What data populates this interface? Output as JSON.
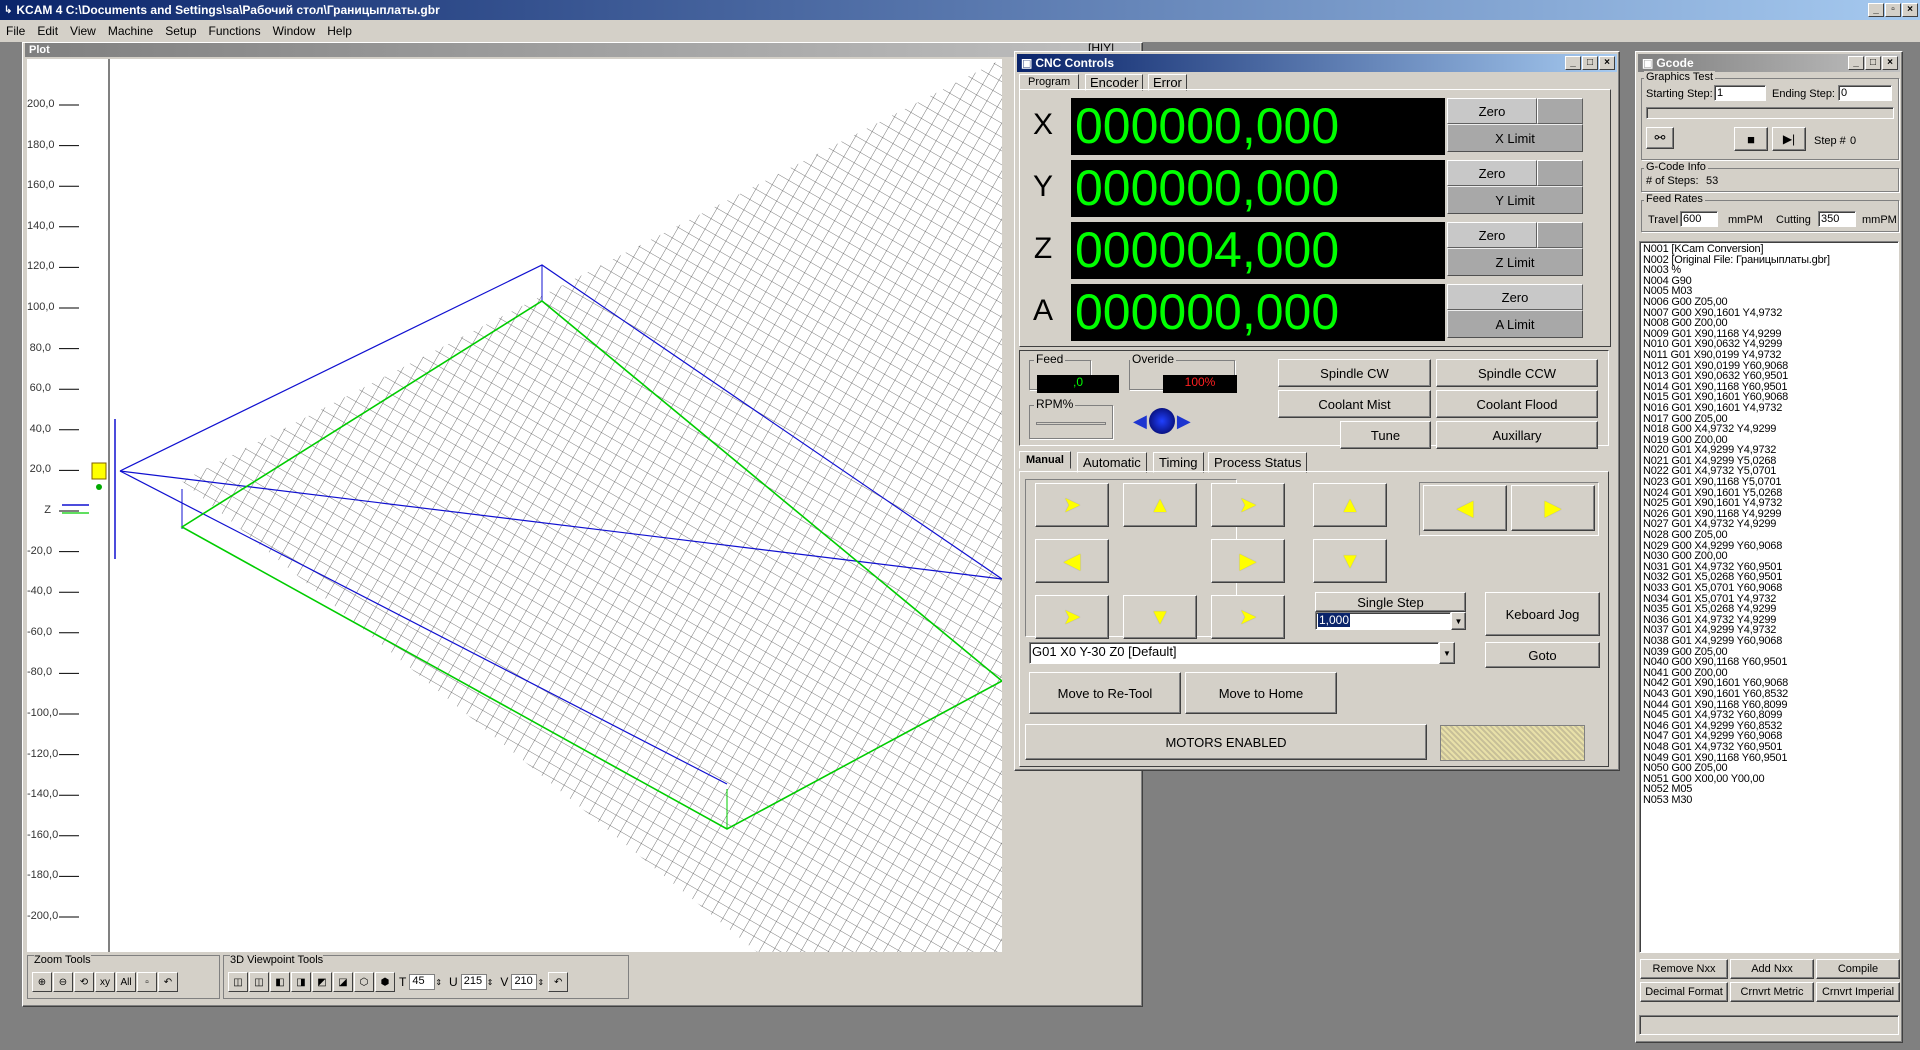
{
  "app": {
    "title": "KCAM 4  C:\\Documents and Settings\\sa\\Рабочий стол\\Границыплаты.gbr",
    "menu": [
      "File",
      "Edit",
      "View",
      "Machine",
      "Setup",
      "Functions",
      "Window",
      "Help"
    ]
  },
  "plot": {
    "title": "Plot",
    "ruler": [
      "200,0",
      "180,0",
      "160,0",
      "140,0",
      "120,0",
      "100,0",
      "80,0",
      "60,0",
      "40,0",
      "20,0",
      "Z",
      "-20,0",
      "-40,0",
      "-60,0",
      "-80,0",
      "-100,0",
      "-120,0",
      "-140,0",
      "-160,0",
      "-180,0",
      "-200,0"
    ],
    "zoom_tools_label": "Zoom Tools",
    "viewpoint_tools_label": "3D Viewpoint Tools",
    "t_label": "T",
    "t_value": "45",
    "u_label": "U",
    "u_value": "215",
    "v_label": "V",
    "v_value": "210",
    "top_hint": "[H|Y|"
  },
  "cnc": {
    "title": "CNC Controls",
    "top_tabs": [
      "Program",
      "Encoder",
      "Error"
    ],
    "axes": [
      {
        "name": "X",
        "value": "000000,000",
        "zero": "Zero",
        "limit": "X Limit"
      },
      {
        "name": "Y",
        "value": "000000,000",
        "zero": "Zero",
        "limit": "Y Limit"
      },
      {
        "name": "Z",
        "value": "000004,000",
        "zero": "Zero",
        "limit": "Z Limit"
      },
      {
        "name": "A",
        "value": "000000,000",
        "zero": "Zero",
        "limit": "A Limit"
      }
    ],
    "feed_label": "Feed",
    "feed_value": ",0",
    "override_label": "Overide",
    "override_value": "100%",
    "rpm_label": "RPM%",
    "spindle_cw": "Spindle CW",
    "spindle_ccw": "Spindle CCW",
    "coolant_mist": "Coolant Mist",
    "coolant_flood": "Coolant Flood",
    "tune": "Tune",
    "auxillary": "Auxillary",
    "mode_tabs": [
      "Manual",
      "Automatic",
      "Timing",
      "Process Status"
    ],
    "single_step": "Single Step",
    "step_value": "1,000",
    "keyboard_jog": "Keboard Jog",
    "command": "G01 X0 Y-30 Z0 [Default]",
    "goto": "Goto",
    "move_retool": "Move to Re-Tool",
    "move_home": "Move to Home",
    "motors": "MOTORS ENABLED"
  },
  "gcode": {
    "title": "Gcode",
    "graphics_test": "Graphics Test",
    "starting_step_label": "Starting Step:",
    "starting_step": "1",
    "ending_step_label": "Ending Step:",
    "ending_step": "0",
    "step_label": "Step #",
    "step_value": "0",
    "info_label": "G-Code Info",
    "steps_label": "# of Steps:",
    "steps_value": "53",
    "feed_rates_label": "Feed Rates",
    "travel_label": "Travel",
    "travel_value": "600",
    "travel_unit": "mmPM",
    "cutting_label": "Cutting",
    "cutting_value": "350",
    "cutting_unit": "mmPM",
    "lines": [
      "N001 [KCam Conversion]",
      "N002 [Original File: Границыплаты.gbr]",
      "N003 %",
      "N004 G90",
      "N005 M03",
      "N006 G00 Z05,00",
      "N007 G00 X90,1601 Y4,9732",
      "N008 G00 Z00,00",
      "N009 G01 X90,1168 Y4,9299",
      "N010 G01 X90,0632 Y4,9299",
      "N011 G01 X90,0199 Y4,9732",
      "N012 G01 X90,0199 Y60,9068",
      "N013 G01 X90,0632 Y60,9501",
      "N014 G01 X90,1168 Y60,9501",
      "N015 G01 X90,1601 Y60,9068",
      "N016 G01 X90,1601 Y4,9732",
      "N017 G00 Z05,00",
      "N018 G00 X4,9732 Y4,9299",
      "N019 G00 Z00,00",
      "N020 G01 X4,9299 Y4,9732",
      "N021 G01 X4,9299 Y5,0268",
      "N022 G01 X4,9732 Y5,0701",
      "N023 G01 X90,1168 Y5,0701",
      "N024 G01 X90,1601 Y5,0268",
      "N025 G01 X90,1601 Y4,9732",
      "N026 G01 X90,1168 Y4,9299",
      "N027 G01 X4,9732 Y4,9299",
      "N028 G00 Z05,00",
      "N029 G00 X4,9299 Y60,9068",
      "N030 G00 Z00,00",
      "N031 G01 X4,9732 Y60,9501",
      "N032 G01 X5,0268 Y60,9501",
      "N033 G01 X5,0701 Y60,9068",
      "N034 G01 X5,0701 Y4,9732",
      "N035 G01 X5,0268 Y4,9299",
      "N036 G01 X4,9732 Y4,9299",
      "N037 G01 X4,9299 Y4,9732",
      "N038 G01 X4,9299 Y60,9068",
      "N039 G00 Z05,00",
      "N040 G00 X90,1168 Y60,9501",
      "N041 G00 Z00,00",
      "N042 G01 X90,1601 Y60,9068",
      "N043 G01 X90,1601 Y60,8532",
      "N044 G01 X90,1168 Y60,8099",
      "N045 G01 X4,9732 Y60,8099",
      "N046 G01 X4,9299 Y60,8532",
      "N047 G01 X4,9299 Y60,9068",
      "N048 G01 X4,9732 Y60,9501",
      "N049 G01 X90,1168 Y60,9501",
      "N050 G00 Z05,00",
      "N051 G00 X00,00 Y00,00",
      "N052 M05",
      "N053 M30"
    ],
    "remove": "Remove  Nxx",
    "add": "Add Nxx",
    "compile": "Compile",
    "decimal": "Decimal Format",
    "metric": "Crnvrt Metric",
    "imperial": "Crnvrt Imperial"
  }
}
